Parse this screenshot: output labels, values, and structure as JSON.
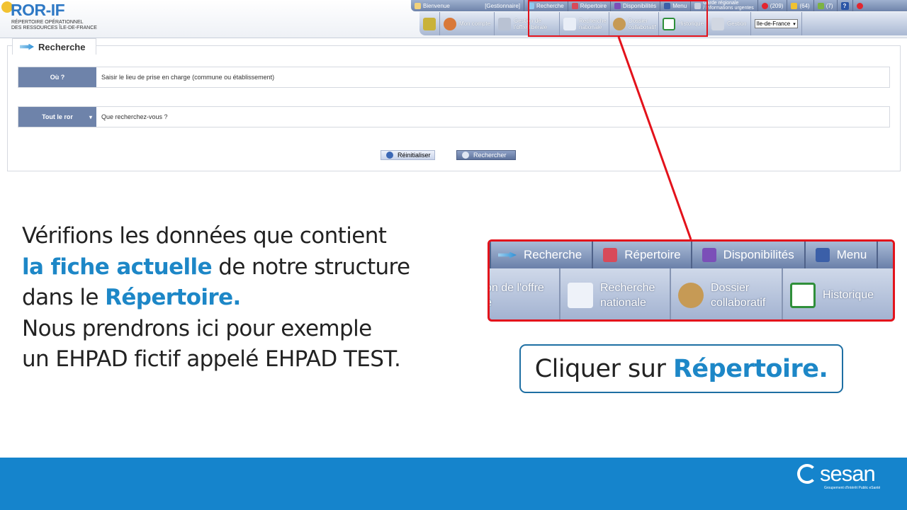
{
  "logo": {
    "title": "ROR-IF",
    "subtitle_line1": "RÉPERTOIRE OPÉRATIONNEL",
    "subtitle_line2": "DES RESSOURCES ÎLE-DE-FRANCE"
  },
  "topbar": {
    "welcome": "Bienvenue",
    "role": "[Gestionnaire]",
    "items": [
      "Recherche",
      "Répertoire",
      "Disponibilités",
      "Menu"
    ],
    "garde_line1": "Garde régionale",
    "garde_line2": "/ Informations urgentes",
    "count_alerts": "(209)",
    "count_notifications": "(64)",
    "count_messages": "(7)",
    "help": "?"
  },
  "navbar": {
    "items": [
      "Mon compte",
      "Gestion de l'offre libérale",
      "Recherche nationale",
      "Dossier collaboratif",
      "Historique",
      "Gestion"
    ],
    "region": "Ile-de-France"
  },
  "search": {
    "tab_label": "Recherche",
    "where_label": "Où ?",
    "where_placeholder": "Saisir le lieu de prise en charge (commune ou établissement)",
    "scope_label": "Tout le ror",
    "what_placeholder": "Que recherchez-vous ?",
    "reset_label": "Réinitialiser",
    "search_label": "Rechercher"
  },
  "instruction": {
    "line1": "Vérifions les données que contient",
    "line2_hl": "la fiche actuelle",
    "line2_rest": " de notre structure",
    "line3_pre": "dans le ",
    "line3_hl": "Répertoire.",
    "line4": "Nous prendrons ici pour exemple",
    "line5": "un EHPAD fictif appelé EHPAD TEST."
  },
  "zoom": {
    "top_items": [
      "Recherche",
      "Répertoire",
      "Disponibilités",
      "Menu"
    ],
    "bottom_item1_line1": "on de l'offre",
    "bottom_item1_line2": "e",
    "bottom_item2_line1": "Recherche",
    "bottom_item2_line2": "nationale",
    "bottom_item3_line1": "Dossier",
    "bottom_item3_line2": "collaboratif",
    "bottom_item4": "Historique"
  },
  "cta": {
    "pre": "Cliquer sur ",
    "hl": "Répertoire."
  },
  "footer": {
    "brand": "sesan",
    "tagline": "Groupement d'Intérêt Public eSanté"
  },
  "colors": {
    "accent": "#1d87c7",
    "highlight_red": "#e3121b",
    "footer_blue": "#1584cc",
    "nav_blue": "#6e83aa"
  }
}
